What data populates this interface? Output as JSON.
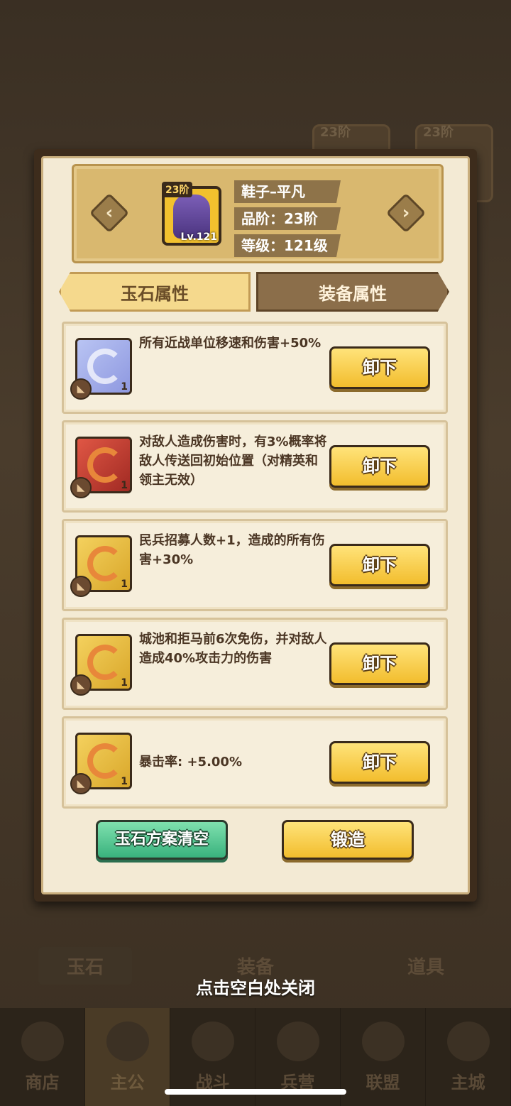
{
  "item": {
    "name": "鞋子–平凡",
    "tier_badge": "23阶",
    "level_badge": "Lv.121",
    "quality": "品阶：23阶",
    "grade": "等级：121级"
  },
  "tabs": [
    {
      "label": "玉石属性",
      "active": true
    },
    {
      "label": "装备属性",
      "active": false
    }
  ],
  "jades": [
    {
      "color": "purple",
      "count": "1",
      "desc": "所有近战单位移速和伤害+50%",
      "button": "卸下"
    },
    {
      "color": "red",
      "count": "1",
      "desc": "对敌人造成伤害时，有3%概率将敌人传送回初始位置（对精英和领主无效）",
      "button": "卸下"
    },
    {
      "color": "gold",
      "count": "1",
      "desc": "民兵招募人数+1，造成的所有伤害+30%",
      "button": "卸下"
    },
    {
      "color": "gold",
      "count": "1",
      "desc": "城池和拒马前6次免伤，并对敌人造成40%攻击力的伤害",
      "button": "卸下"
    },
    {
      "color": "gold",
      "count": "1",
      "desc": "暴击率: +5.00%",
      "button": "卸下"
    }
  ],
  "footer": {
    "clear_label": "玉石方案清空",
    "forge_label": "锻造"
  },
  "close_hint": "点击空白处关闭",
  "background": {
    "tier_badges": [
      "23阶",
      "23阶"
    ],
    "tabs": [
      "玉石",
      "装备",
      "道具"
    ],
    "nav": [
      "商店",
      "主公",
      "战斗",
      "兵营",
      "联盟",
      "主城"
    ]
  },
  "colors": {
    "accent_gold": "#f2bd2d",
    "accent_green": "#39b27d",
    "panel_bg": "#f3ead4"
  }
}
